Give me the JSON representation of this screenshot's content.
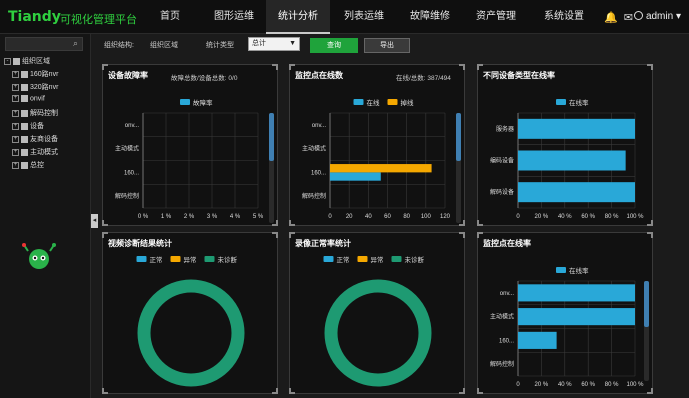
{
  "header": {
    "logo": "Tiandy",
    "app_title": "可视化管理平台",
    "nav": [
      "首页",
      "图形运维",
      "统计分析",
      "列表运维",
      "故障维修",
      "资产管理",
      "系统设置"
    ],
    "active_nav": 2,
    "user": "admin"
  },
  "sidebar": {
    "tree": [
      {
        "label": "组织区域",
        "level": 0,
        "expander": "-"
      },
      {
        "label": "160路nvr",
        "level": 1,
        "expander": "+"
      },
      {
        "label": "320路nvr",
        "level": 1,
        "expander": "+"
      },
      {
        "label": "onvif",
        "level": 1,
        "expander": "+"
      },
      {
        "label": "解码控制",
        "level": 1,
        "expander": "+"
      },
      {
        "label": "设备",
        "level": 1,
        "expander": "+"
      },
      {
        "label": "友商设备",
        "level": 1,
        "expander": "+"
      },
      {
        "label": "主动模式",
        "level": 1,
        "expander": "+"
      },
      {
        "label": "总控",
        "level": 1,
        "expander": "+"
      }
    ]
  },
  "filters": {
    "org_label": "组织结构:",
    "org_value": "组织区域",
    "type_label": "统计类型",
    "type_value": "总计",
    "query_btn": "查询",
    "export_btn": "导出"
  },
  "panels": {
    "p1": {
      "title": "设备故障率",
      "sub": "故障总数/设备总数: 0/0"
    },
    "p2": {
      "title": "监控点在线数",
      "sub": "在线/总数: 387/494"
    },
    "p3": {
      "title": "不同设备类型在线率",
      "sub": ""
    },
    "p4": {
      "title": "视频诊断结果统计",
      "sub": ""
    },
    "p5": {
      "title": "录像正常率统计",
      "sub": ""
    },
    "p6": {
      "title": "监控点在线率",
      "sub": ""
    }
  },
  "chart_data": [
    {
      "type": "bar",
      "orientation": "horizontal",
      "categories": [
        "onv...",
        "主动模式",
        "160...",
        "解码控制"
      ],
      "series": [
        {
          "name": "故障率",
          "values": [
            0,
            0,
            0,
            0
          ],
          "color": "#29a8d8"
        }
      ],
      "xticks": [
        "0 %",
        "1 %",
        "2 %",
        "3 %",
        "4 %",
        "5 %"
      ],
      "xlim": [
        0,
        5
      ]
    },
    {
      "type": "bar",
      "orientation": "horizontal",
      "categories": [
        "onv...",
        "主动模式",
        "160...",
        "解码控制"
      ],
      "series": [
        {
          "name": "在线",
          "values": [
            0,
            0,
            53,
            0
          ],
          "color": "#29a8d8"
        },
        {
          "name": "掉线",
          "values": [
            0,
            0,
            106,
            0
          ],
          "color": "#f5a800"
        }
      ],
      "xticks": [
        "0",
        "20",
        "40",
        "60",
        "80",
        "100",
        "120"
      ],
      "xlim": [
        0,
        120
      ]
    },
    {
      "type": "bar",
      "orientation": "horizontal",
      "categories": [
        "服务器",
        "编码设备",
        "解码设备"
      ],
      "series": [
        {
          "name": "在线率",
          "values": [
            100,
            92,
            100
          ],
          "color": "#29a8d8"
        }
      ],
      "xticks": [
        "0",
        "20 %",
        "40 %",
        "60 %",
        "80 %",
        "100 %"
      ],
      "xlim": [
        0,
        100
      ]
    },
    {
      "type": "pie",
      "legend": [
        {
          "name": "正常",
          "color": "#29a8d8"
        },
        {
          "name": "异常",
          "color": "#f5a800"
        },
        {
          "name": "未诊断",
          "color": "#1e9a72"
        }
      ],
      "slices": [
        {
          "name": "未诊断",
          "value": 100,
          "color": "#1e9a72"
        }
      ]
    },
    {
      "type": "pie",
      "legend": [
        {
          "name": "正常",
          "color": "#29a8d8"
        },
        {
          "name": "异常",
          "color": "#f5a800"
        },
        {
          "name": "未诊断",
          "color": "#1e9a72"
        }
      ],
      "slices": [
        {
          "name": "未诊断",
          "value": 100,
          "color": "#1e9a72"
        }
      ]
    },
    {
      "type": "bar",
      "orientation": "horizontal",
      "categories": [
        "onv...",
        "主动模式",
        "160...",
        "解码控制"
      ],
      "series": [
        {
          "name": "在线率",
          "values": [
            100,
            100,
            33,
            0
          ],
          "color": "#29a8d8"
        }
      ],
      "xticks": [
        "0",
        "20 %",
        "40 %",
        "60 %",
        "80 %",
        "100 %"
      ],
      "xlim": [
        0,
        100
      ]
    }
  ]
}
